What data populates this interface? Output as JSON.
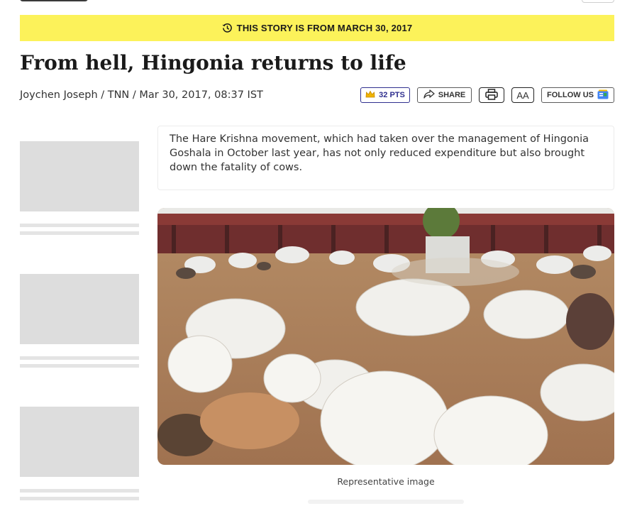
{
  "banner": {
    "icon": "history-clock-icon",
    "text": "THIS STORY IS FROM MARCH 30, 2017"
  },
  "article": {
    "headline": "From hell, Hingonia returns to life",
    "byline": "Joychen Joseph / TNN / Mar 30, 2017, 08:37 IST",
    "summary": "The Hare Krishna movement, which had taken over the management of Hingonia Goshala in October last year, has not only reduced expenditure but also brought down the fatality of cows.",
    "image_caption": "Representative image"
  },
  "toolbar": {
    "points_label": "32 PTS",
    "points_icon": "crown-icon",
    "share_label": "SHARE",
    "share_icon": "share-arrow-icon",
    "print_icon": "printer-icon",
    "font_size_label": "AA",
    "follow_label": "FOLLOW US",
    "follow_icon": "google-news-icon"
  },
  "colors": {
    "banner_bg": "#fcf25a",
    "points_accent": "#2f2f8f",
    "placeholder": "#dddddd"
  }
}
